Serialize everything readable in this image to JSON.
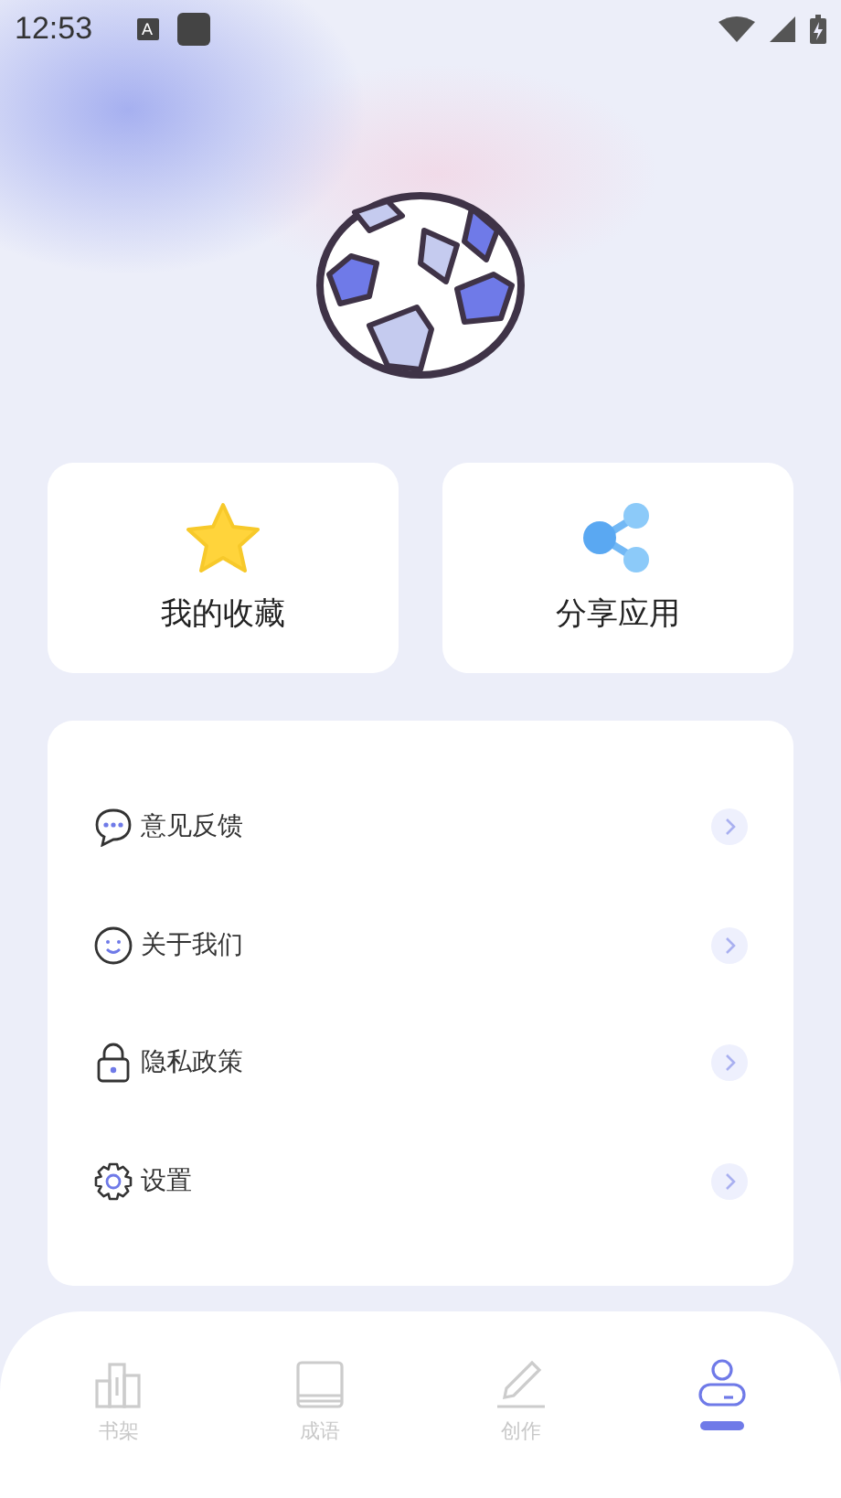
{
  "status_bar": {
    "time": "12:53",
    "badge": "A"
  },
  "quick_cards": [
    {
      "kind": "star",
      "label": "我的收藏"
    },
    {
      "kind": "share",
      "label": "分享应用"
    }
  ],
  "menu": [
    {
      "kind": "feedback",
      "label": "意见反馈"
    },
    {
      "kind": "about",
      "label": "关于我们"
    },
    {
      "kind": "privacy",
      "label": "隐私政策"
    },
    {
      "kind": "settings",
      "label": "设置"
    }
  ],
  "tabs": [
    {
      "kind": "shelf",
      "label": "书架",
      "selected": false
    },
    {
      "kind": "idiom",
      "label": "成语",
      "selected": false
    },
    {
      "kind": "create",
      "label": "创作",
      "selected": false
    },
    {
      "kind": "profile",
      "selected": true
    }
  ]
}
